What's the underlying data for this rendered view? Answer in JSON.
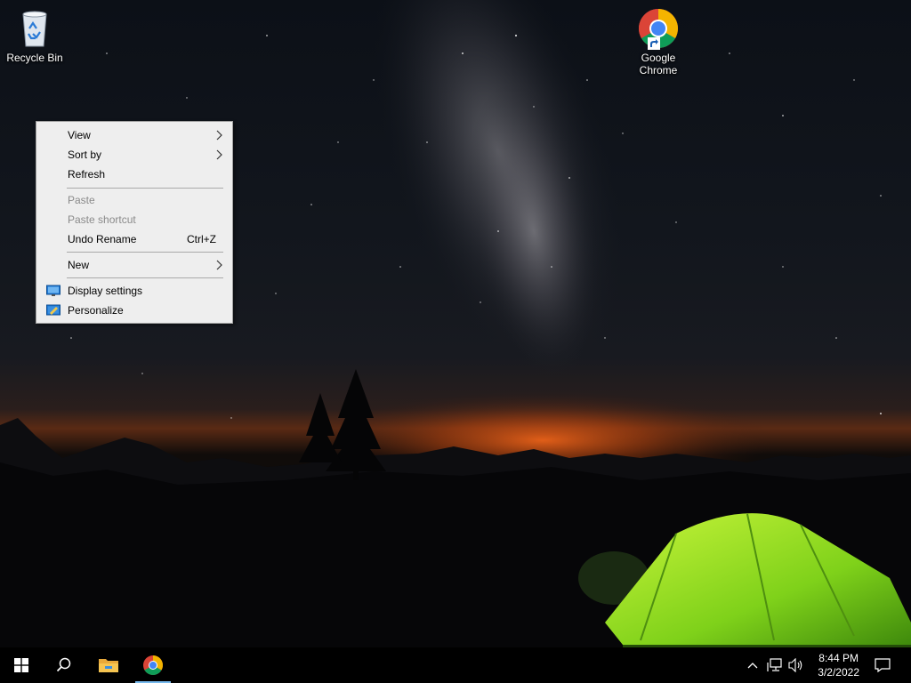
{
  "desktop": {
    "icons": [
      {
        "label": "Recycle Bin"
      },
      {
        "label_line1": "Google",
        "label_line2": "Chrome"
      }
    ]
  },
  "context_menu": {
    "items": [
      {
        "label": "View",
        "submenu": true,
        "enabled": true
      },
      {
        "label": "Sort by",
        "submenu": true,
        "enabled": true
      },
      {
        "label": "Refresh",
        "enabled": true
      },
      {
        "label": "Paste",
        "enabled": false
      },
      {
        "label": "Paste shortcut",
        "enabled": false
      },
      {
        "label": "Undo Rename",
        "shortcut": "Ctrl+Z",
        "enabled": true
      },
      {
        "label": "New",
        "submenu": true,
        "enabled": true
      },
      {
        "label": "Display settings",
        "icon": "display-icon",
        "enabled": true
      },
      {
        "label": "Personalize",
        "icon": "personalize-icon",
        "enabled": true
      }
    ]
  },
  "taskbar": {
    "buttons": [
      {
        "name": "start",
        "icon": "windows-logo-icon"
      },
      {
        "name": "search",
        "icon": "search-icon"
      },
      {
        "name": "file-explorer",
        "icon": "folder-icon"
      },
      {
        "name": "chrome",
        "icon": "chrome-icon",
        "active": true
      }
    ],
    "tray_icons": [
      "chevron-up-icon",
      "network-icon",
      "volume-icon"
    ],
    "clock": {
      "time": "8:44 PM",
      "date": "3/2/2022"
    },
    "notification_icon": "notification-icon"
  },
  "colors": {
    "menu_bg": "#eeeeee",
    "disabled_text": "#8a8a8a",
    "taskbar_bg": "#000000",
    "active_underline": "#76b9ed"
  }
}
